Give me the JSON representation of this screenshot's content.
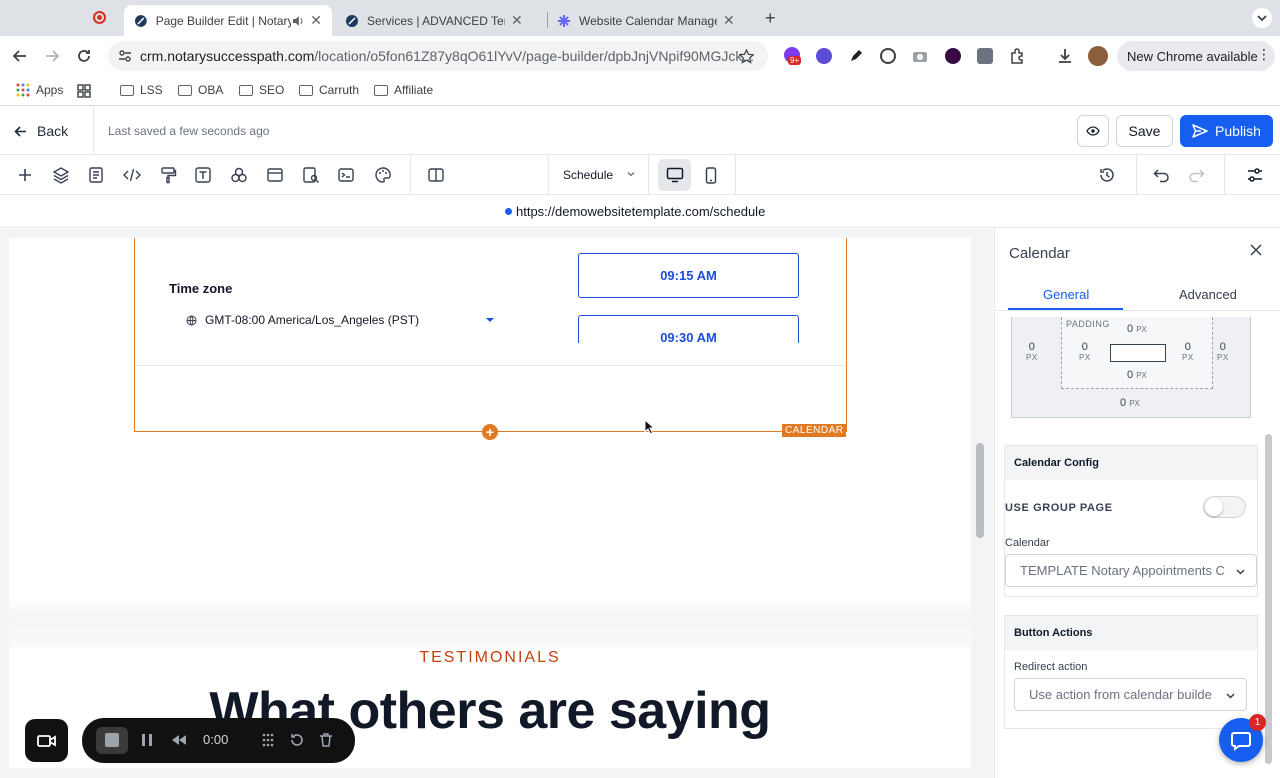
{
  "browser": {
    "tabs": [
      {
        "title": "Page Builder Edit | Notary",
        "active": true
      },
      {
        "title": "Services | ADVANCED Templa",
        "active": false
      },
      {
        "title": "Website Calendar Manageme",
        "active": false
      }
    ],
    "url_host": "crm.notarysuccesspath.com",
    "url_path": "/location/o5fon61Z87y8qO61lYvV/page-builder/dpbJnjVNpif90MGJck...",
    "new_chrome_label": "New Chrome available",
    "extension_badge": "9+",
    "bookmarks": [
      "Apps",
      "LSS",
      "OBA",
      "SEO",
      "Carruth",
      "Affiliate"
    ]
  },
  "builder": {
    "back_label": "Back",
    "saved_status": "Last saved a few seconds ago",
    "save_label": "Save",
    "publish_label": "Publish",
    "page_select": "Schedule",
    "preview_url": "https://demowebsitetemplate.com/schedule"
  },
  "canvas": {
    "timezone_label": "Time zone",
    "timezone_value": "GMT-08:00 America/Los_Angeles (PST)",
    "slots": [
      "09:15 AM",
      "09:30 AM"
    ],
    "element_tag": "CALENDAR",
    "section_eyebrow": "TESTIMONIALS",
    "section_heading": "What others are saying"
  },
  "panel": {
    "title": "Calendar",
    "tabs": [
      "General",
      "Advanced"
    ],
    "spacing": {
      "padding_label": "PADDING",
      "margin_left": "0",
      "padding_left": "0",
      "padding_top": "0",
      "padding_right": "0",
      "margin_right": "0",
      "padding_bottom": "0",
      "margin_bottom": "0",
      "unit": "PX"
    },
    "calendar_config": {
      "header": "Calendar Config",
      "group_page_label": "USE GROUP PAGE",
      "group_page_on": false,
      "calendar_label": "Calendar",
      "calendar_value": "TEMPLATE Notary Appointments C"
    },
    "button_actions": {
      "header": "Button Actions",
      "redirect_label": "Redirect action",
      "redirect_value": "Use action from calendar builde"
    },
    "chat_badge": "1"
  },
  "recorder": {
    "time": "0:00"
  },
  "colors": {
    "accent": "#155eef",
    "selection": "#e07b24",
    "eyebrow": "#c2410c"
  }
}
